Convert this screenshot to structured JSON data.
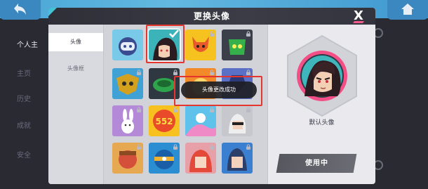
{
  "modal": {
    "title": "更换头像",
    "close_label": "X"
  },
  "sidebar": {
    "tabs": [
      {
        "label": "头像",
        "active": true
      },
      {
        "label": "头像框",
        "active": false
      }
    ]
  },
  "avatars": [
    {
      "name": "robot-avatar",
      "locked": false,
      "selected": false
    },
    {
      "name": "dark-haired-girl-avatar",
      "locked": false,
      "selected": true
    },
    {
      "name": "yellow-creature-avatar",
      "locked": true,
      "selected": false
    },
    {
      "name": "green-monster-avatar",
      "locked": true,
      "selected": false
    },
    {
      "name": "owl-emblem-avatar",
      "locked": true,
      "selected": false
    },
    {
      "name": "green-bomb-avatar",
      "locked": true,
      "selected": false
    },
    {
      "name": "orange-avatar",
      "locked": true,
      "selected": false
    },
    {
      "name": "blue-shield-avatar",
      "locked": true,
      "selected": false
    },
    {
      "name": "bunny-avatar",
      "locked": true,
      "selected": false
    },
    {
      "name": "552-badge-avatar",
      "locked": true,
      "selected": false
    },
    {
      "name": "sky-blue-avatar",
      "locked": true,
      "selected": false
    },
    {
      "name": "silver-hair-avatar",
      "locked": true,
      "selected": false
    },
    {
      "name": "red-cap-avatar",
      "locked": true,
      "selected": false
    },
    {
      "name": "blue-orb-avatar",
      "locked": true,
      "selected": false
    },
    {
      "name": "red-hair-girl-avatar",
      "locked": true,
      "selected": false
    },
    {
      "name": "blue-hair-boy-avatar",
      "locked": true,
      "selected": false
    }
  ],
  "toast": {
    "message": "头像更改成功"
  },
  "preview": {
    "label": "默认头像",
    "use_button_label": "使用中"
  },
  "background": {
    "left_items": [
      "个人主",
      "主页",
      "历史",
      "成就",
      "安全"
    ]
  },
  "colors": {
    "accent_red": "#e4352f",
    "modal_header": "#34343e",
    "stripe_teal": "#46c2d6",
    "close_pink": "#f25a8a"
  }
}
